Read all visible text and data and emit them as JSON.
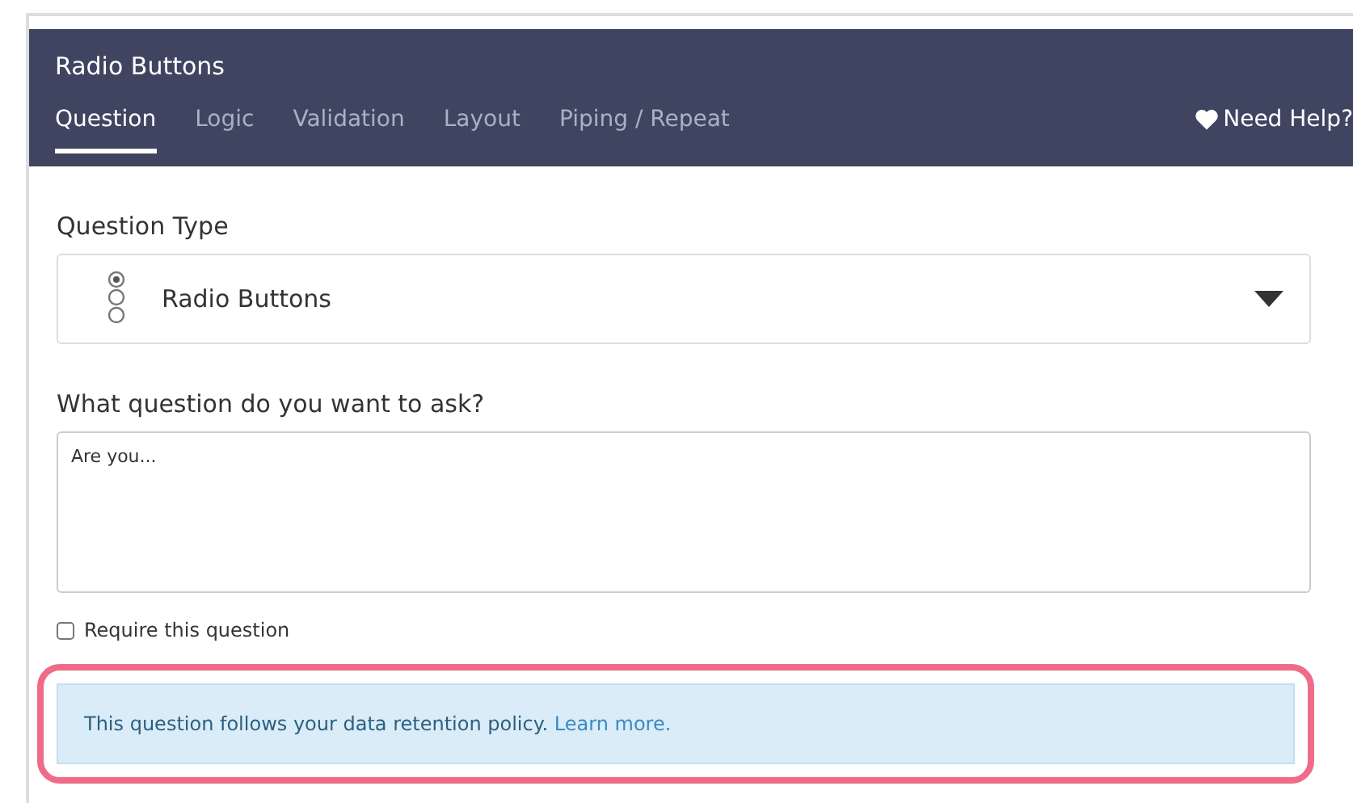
{
  "header": {
    "title": "Radio Buttons",
    "help": "Need Help?"
  },
  "tabs": [
    {
      "label": "Question",
      "selected": true
    },
    {
      "label": "Logic",
      "selected": false
    },
    {
      "label": "Validation",
      "selected": false
    },
    {
      "label": "Layout",
      "selected": false
    },
    {
      "label": "Piping / Repeat",
      "selected": false
    }
  ],
  "question_type": {
    "label": "Question Type",
    "value": "Radio Buttons"
  },
  "question": {
    "label": "What question do you want to ask?",
    "value": "Are you..."
  },
  "require": {
    "label": "Require this question",
    "checked": false
  },
  "notice": {
    "text": "This question follows your data retention policy.",
    "link": "Learn more.",
    "highlighted": true
  }
}
